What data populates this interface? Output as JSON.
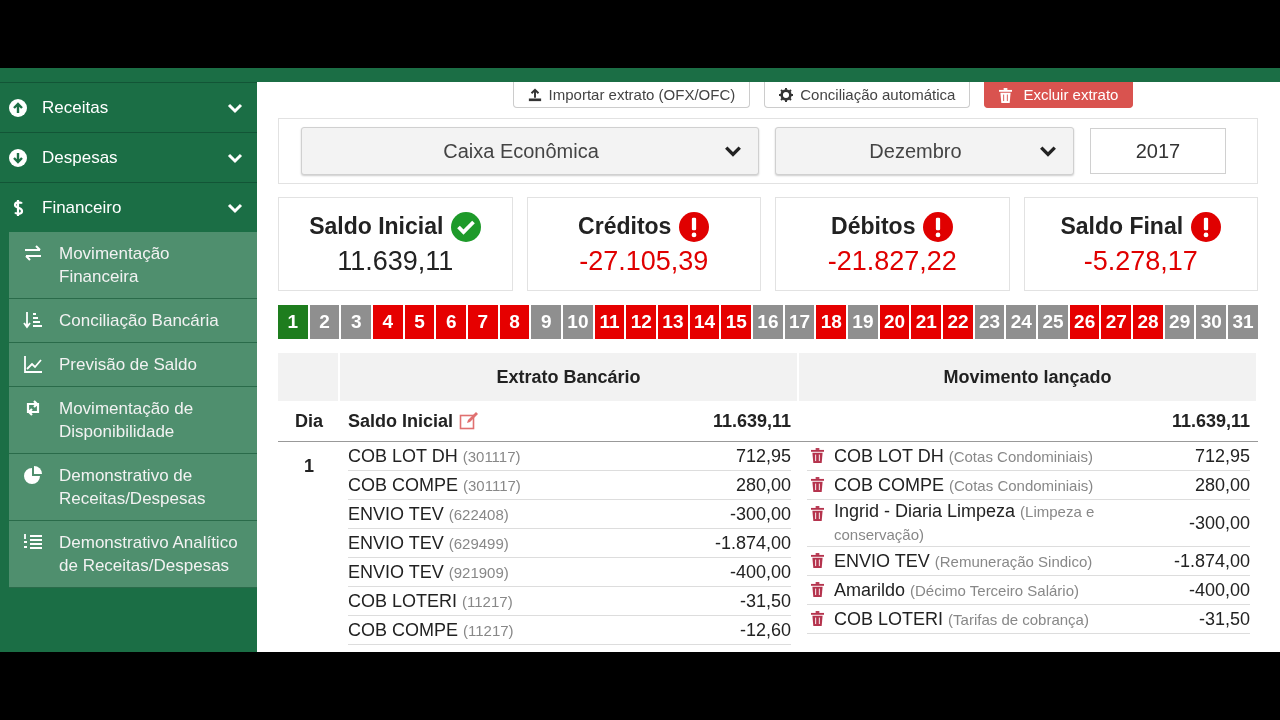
{
  "sidebar": {
    "items": [
      {
        "label": "Receitas",
        "kind": "up"
      },
      {
        "label": "Despesas",
        "kind": "down"
      },
      {
        "label": "Financeiro",
        "kind": "money",
        "children": [
          {
            "label": "Movimentação Financeira",
            "kind": "exchange"
          },
          {
            "label": "Conciliação Bancária",
            "kind": "sort"
          },
          {
            "label": "Previsão de Saldo",
            "kind": "chart"
          },
          {
            "label": "Movimentação de Disponibilidade",
            "kind": "retweet"
          },
          {
            "label": "Demonstrativo de Receitas/Despesas",
            "kind": "pie"
          },
          {
            "label": "Demonstrativo Analítico de Receitas/Despesas",
            "kind": "list"
          }
        ]
      }
    ]
  },
  "toolbar": {
    "buttons": [
      {
        "label": "Importar extrato (OFX/OFC)",
        "kind": "import"
      },
      {
        "label": "Conciliação automática",
        "kind": "auto"
      },
      {
        "label": "Excluir extrato",
        "kind": "delete"
      }
    ]
  },
  "filters": {
    "account": "Caixa Econômica",
    "month": "Dezembro",
    "year": "2017"
  },
  "summary": [
    {
      "label": "Saldo Inicial",
      "value": "11.639,11",
      "kind": "ok"
    },
    {
      "label": "Créditos",
      "value": "-27.105,39",
      "kind": "alert"
    },
    {
      "label": "Débitos",
      "value": "-21.827,22",
      "kind": "alert"
    },
    {
      "label": "Saldo Final",
      "value": "-5.278,17",
      "kind": "alert"
    }
  ],
  "days": [
    {
      "label": "1",
      "color": "#1e7d1e"
    },
    {
      "label": "2",
      "color": "#8f8f8f"
    },
    {
      "label": "3",
      "color": "#8f8f8f"
    },
    {
      "label": "4",
      "color": "#e60000"
    },
    {
      "label": "5",
      "color": "#e60000"
    },
    {
      "label": "6",
      "color": "#e60000"
    },
    {
      "label": "7",
      "color": "#e60000"
    },
    {
      "label": "8",
      "color": "#e60000"
    },
    {
      "label": "9",
      "color": "#8f8f8f"
    },
    {
      "label": "10",
      "color": "#8f8f8f"
    },
    {
      "label": "11",
      "color": "#e60000"
    },
    {
      "label": "12",
      "color": "#e60000"
    },
    {
      "label": "13",
      "color": "#e60000"
    },
    {
      "label": "14",
      "color": "#e60000"
    },
    {
      "label": "15",
      "color": "#e60000"
    },
    {
      "label": "16",
      "color": "#8f8f8f"
    },
    {
      "label": "17",
      "color": "#8f8f8f"
    },
    {
      "label": "18",
      "color": "#e60000"
    },
    {
      "label": "19",
      "color": "#8f8f8f"
    },
    {
      "label": "20",
      "color": "#e60000"
    },
    {
      "label": "21",
      "color": "#e60000"
    },
    {
      "label": "22",
      "color": "#e60000"
    },
    {
      "label": "23",
      "color": "#8f8f8f"
    },
    {
      "label": "24",
      "color": "#8f8f8f"
    },
    {
      "label": "25",
      "color": "#8f8f8f"
    },
    {
      "label": "26",
      "color": "#e60000"
    },
    {
      "label": "27",
      "color": "#e60000"
    },
    {
      "label": "28",
      "color": "#e60000"
    },
    {
      "label": "29",
      "color": "#8f8f8f"
    },
    {
      "label": "30",
      "color": "#8f8f8f"
    },
    {
      "label": "31",
      "color": "#8f8f8f"
    }
  ],
  "table": {
    "columns": [
      "Extrato Bancário",
      "Movimento lançado"
    ],
    "opening": {
      "day_label": "Dia",
      "label": "Saldo Inicial",
      "bank_value": "11.639,11",
      "ledger_value": "11.639,11"
    },
    "day": "1",
    "bank_rows": [
      {
        "description": "COB LOT DH",
        "ref": "(301117)",
        "amount": "712,95"
      },
      {
        "description": "COB COMPE",
        "ref": "(301117)",
        "amount": "280,00"
      },
      {
        "description": "ENVIO TEV",
        "ref": "(622408)",
        "amount": "-300,00"
      },
      {
        "description": "ENVIO TEV",
        "ref": "(629499)",
        "amount": "-1.874,00"
      },
      {
        "description": "ENVIO TEV",
        "ref": "(921909)",
        "amount": "-400,00"
      },
      {
        "description": "COB LOTERI",
        "ref": "(11217)",
        "amount": "-31,50"
      },
      {
        "description": "COB COMPE",
        "ref": "(11217)",
        "amount": "-12,60"
      }
    ],
    "ledger_rows": [
      {
        "description": "COB LOT DH",
        "category": "(Cotas Condominiais)",
        "amount": "712,95"
      },
      {
        "description": "COB COMPE",
        "category": "(Cotas Condominiais)",
        "amount": "280,00"
      },
      {
        "description": "Ingrid - Diaria Limpeza",
        "category": "(Limpeza e conservação)",
        "amount": "-300,00"
      },
      {
        "description": "ENVIO TEV",
        "category": "(Remuneração Sindico)",
        "amount": "-1.874,00"
      },
      {
        "description": "Amarildo",
        "category": "(Décimo Terceiro Salário)",
        "amount": "-400,00"
      },
      {
        "description": "COB LOTERI",
        "category": "(Tarifas de cobrança)",
        "amount": "-31,50"
      }
    ]
  }
}
